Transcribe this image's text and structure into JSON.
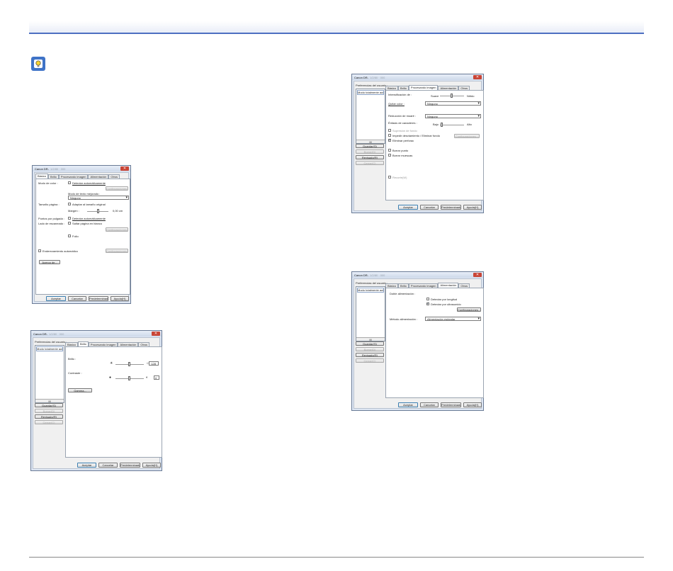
{
  "hint": {
    "icon": "lightbulb-icon",
    "color": "#3f73c7"
  },
  "win1": {
    "title": "Canon DR-",
    "title_model": "1/2/80 · 000",
    "tabs": [
      "Básico",
      "Brillo",
      "Procesando imagen",
      "Alimentación",
      "Otros"
    ],
    "modo_color_label": "Modo de color :",
    "detectar_auto": "Detectar automáticamente",
    "configuraciones": "Configuraciones...",
    "modo_texto_label": "Modo de texto mejorado :",
    "modo_texto_value": "Ninguno",
    "tamano_label": "Tamaño página :",
    "adaptar_original": "Adaptar al tamaño original",
    "margen_label": "Margen :",
    "margen_value": "0,00 cm",
    "puntos_label": "Puntos por pulgada :",
    "puntos_detectar": "Detectar automáticamente",
    "lado_label": "Lado de escaneado :",
    "saltar_blanco": "Saltar página en blanco",
    "configuraciones2": "Configuraciones...",
    "folio": "Folio",
    "endereza": "Enderezamiento automático",
    "configuraciones3": "Configuraciones...",
    "acerca": "Acerca de...",
    "aceptar": "Aceptar",
    "cancelar": "Cancelar",
    "predeterminado": "Predeterminado",
    "ayuda": "Ayuda(H)"
  },
  "win2": {
    "title": "Canon DR-",
    "title_model": "1/2/80 · 000",
    "pref_label": "Preferencias del usuario :",
    "list_item": "Modo totalmente autom",
    "scroll_mid": "III",
    "guardar": "Guardar(S)",
    "borrar": "Borrar(D)",
    "revisado": "Revisado(R)",
    "cerrar": "Cerrar(C)",
    "tabs": [
      "Básico",
      "Brillo",
      "Procesando imagen",
      "Alimentación",
      "Otros"
    ],
    "brillo_label": "Brillo :",
    "brillo_value": "128",
    "contraste_label": "Contraste :",
    "contraste_value": "4",
    "gamma": "Gamma...",
    "aceptar": "Aceptar",
    "cancelar": "Cancelar",
    "predeterminado": "Predeterminado",
    "ayuda": "Ayuda(H)"
  },
  "win3": {
    "title": "Canon DR-",
    "title_model": "1/2/80 · 000",
    "pref_label": "Preferencias del usuario :",
    "list_item": "Modo totalmente autom",
    "scroll_mid": "III",
    "guardar": "Guardar(S)",
    "borrar": "Borrar(D)",
    "revisado": "Revisado(R)",
    "cerrar": "Cerrar(C)",
    "tabs": [
      "Básico",
      "Brillo",
      "Procesando imagen",
      "Alimentación",
      "Otros"
    ],
    "intensificacion_label": "Intensificación de :",
    "suave": "Suave",
    "nitido": "Nítido",
    "quitar_color_label": "Quitar color :",
    "quitar_color_value": "Ninguno",
    "reduccion_label": "Reducción de moaré :",
    "reduccion_value": "Ninguno",
    "enfasis_label": "Énfasis de caracteres :",
    "bajo": "Bajo",
    "alto": "Alto",
    "supresion": "Supresión de fondo",
    "impedir": "Impedir desviamiento / Eliminar fondo",
    "configuraciones": "Configuraciones...",
    "eliminar_perforac": "Eliminar perforac",
    "borrar_punto": "Borrar punto",
    "borrar_muescas": "Borrar muescas",
    "recorte": "Recorte(W)",
    "aceptar": "Aceptar",
    "cancelar": "Cancelar",
    "predeterminado": "Predeterminado",
    "ayuda": "Ayuda(H)"
  },
  "win4": {
    "title": "Canon DR-",
    "title_model": "1/2/80 · 000",
    "pref_label": "Preferencias del usuario :",
    "list_item": "Modo totalmente autom",
    "scroll_mid": "III",
    "guardar": "Guardar(S)",
    "borrar": "Borrar(D)",
    "revisado": "Revisado(R)",
    "cerrar": "Cerrar(C)",
    "tabs": [
      "Básico",
      "Brillo",
      "Procesando imagen",
      "Alimentación",
      "Otros"
    ],
    "doble_label": "Doble alimentación :",
    "detectar_longitud": "Detectar por longitud",
    "detectar_ultrasonido": "Detectar por ultrasonido",
    "configuraciones": "Configuraciones...",
    "metodo_label": "Método alimentación :",
    "metodo_value": "Alimentación estándar",
    "aceptar": "Aceptar",
    "cancelar": "Cancelar",
    "predeterminado": "Predeterminado",
    "ayuda": "Ayuda(H)"
  }
}
